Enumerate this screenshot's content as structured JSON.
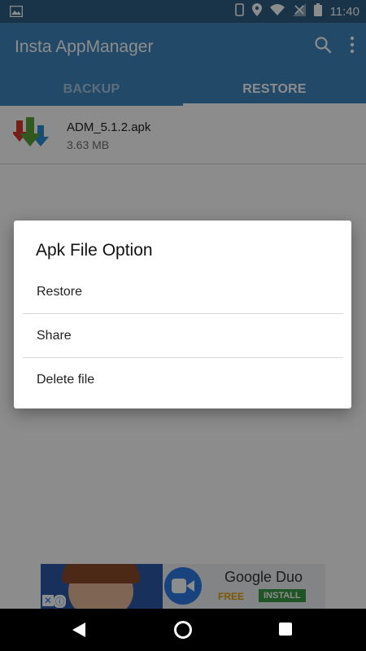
{
  "status_bar": {
    "time": "11:40",
    "icons": [
      "image-notification-icon",
      "phone-icon",
      "location-icon",
      "wifi-icon",
      "signal-icon",
      "battery-icon"
    ]
  },
  "app_bar": {
    "title": "Insta AppManager",
    "tabs": [
      {
        "label": "BACKUP",
        "active": false
      },
      {
        "label": "RESTORE",
        "active": true
      }
    ]
  },
  "files": [
    {
      "name": "ADM_5.1.2.apk",
      "size": "3.63 MB"
    }
  ],
  "dialog": {
    "title": "Apk File Option",
    "options": [
      "Restore",
      "Share",
      "Delete file"
    ]
  },
  "ad": {
    "title": "Google Duo",
    "free_label": "FREE",
    "install_label": "INSTALL"
  },
  "colors": {
    "status_bar": "#2e5f86",
    "app_bar": "#3f85bd",
    "install_green": "#3a9a45",
    "free_orange": "#e6a100"
  }
}
